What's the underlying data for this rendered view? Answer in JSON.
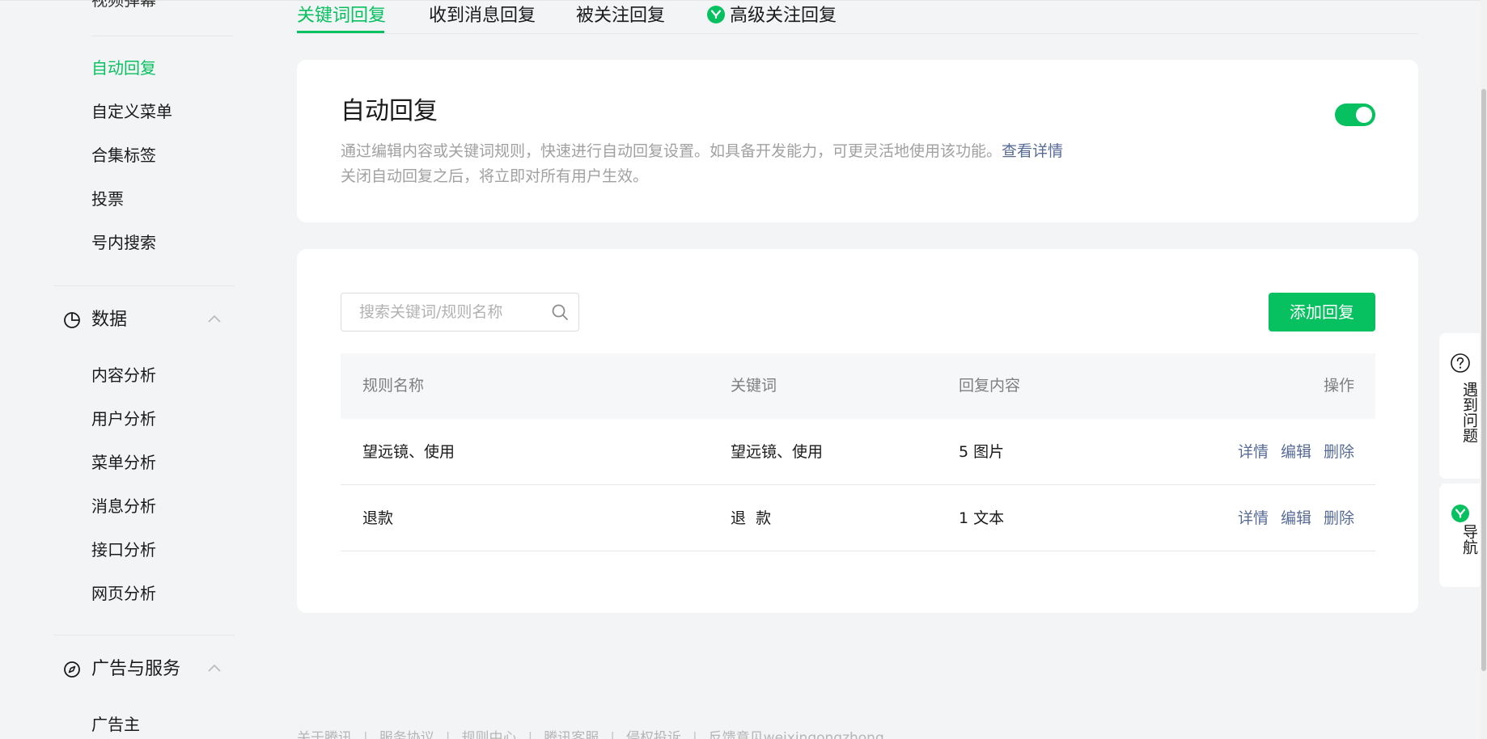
{
  "sidebar": {
    "cut_item": "视频弹幕",
    "items_top": [
      {
        "label": "自动回复",
        "active": true
      },
      {
        "label": "自定义菜单"
      },
      {
        "label": "合集标签"
      },
      {
        "label": "投票"
      },
      {
        "label": "号内搜索"
      }
    ],
    "section_data": {
      "label": "数据",
      "icon": "pie-chart-icon",
      "expanded": true
    },
    "data_items": [
      {
        "label": "内容分析"
      },
      {
        "label": "用户分析"
      },
      {
        "label": "菜单分析"
      },
      {
        "label": "消息分析"
      },
      {
        "label": "接口分析"
      },
      {
        "label": "网页分析"
      }
    ],
    "section_ads": {
      "label": "广告与服务",
      "icon": "compass-icon",
      "expanded": true
    },
    "ads_items": [
      {
        "label": "广告主"
      }
    ]
  },
  "tabs": [
    {
      "label": "关键词回复",
      "active": true
    },
    {
      "label": "收到消息回复"
    },
    {
      "label": "被关注回复"
    },
    {
      "label": "高级关注回复",
      "icon": "advanced-badge-icon"
    }
  ],
  "auto_reply": {
    "title": "自动回复",
    "desc_line1": "通过编辑内容或关键词规则，快速进行自动回复设置。如具备开发能力，可更灵活地使用该功能。",
    "desc_link": "查看详情",
    "desc_line2": "关闭自动回复之后，将立即对所有用户生效。",
    "enabled": true
  },
  "rules": {
    "search_placeholder": "搜索关键词/规则名称",
    "add_button": "添加回复",
    "columns": [
      "规则名称",
      "关键词",
      "回复内容",
      "操作"
    ],
    "rows": [
      {
        "name": "望远镜、使用",
        "keyword": "望远镜、使用",
        "content": "5 图片",
        "ops": [
          "详情",
          "编辑",
          "删除"
        ]
      },
      {
        "name": "退款",
        "keyword": "退  款",
        "content": "1 文本",
        "ops": [
          "详情",
          "编辑",
          "删除"
        ]
      }
    ]
  },
  "footer": [
    "关于腾讯",
    "服务协议",
    "规则中心",
    "腾讯客服",
    "侵权投诉",
    "反馈意见weixingongzhong"
  ],
  "float": {
    "help": "遇到问题",
    "nav": "导航"
  },
  "colors": {
    "accent": "#07c160",
    "link": "#576b95"
  }
}
